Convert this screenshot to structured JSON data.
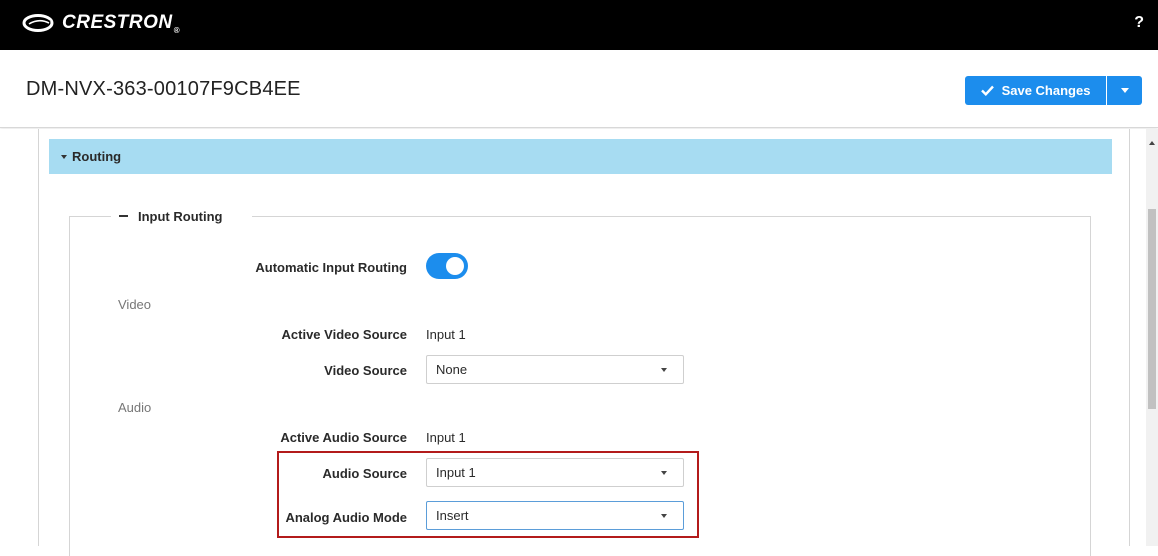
{
  "topbar": {
    "logo_text": "CRESTRON",
    "logo_mark": "®",
    "help_label": "?"
  },
  "header": {
    "device_name": "DM-NVX-363-00107F9CB4EE",
    "save_label": "Save Changes"
  },
  "routing": {
    "section_title": "Routing",
    "group_title": "Input Routing",
    "automatic_input_routing": {
      "label": "Automatic Input Routing",
      "enabled": true
    },
    "video": {
      "heading": "Video",
      "active_source_label": "Active Video Source",
      "active_source_value": "Input 1",
      "source_label": "Video Source",
      "source_value": "None"
    },
    "audio": {
      "heading": "Audio",
      "active_source_label": "Active Audio Source",
      "active_source_value": "Input 1",
      "source_label": "Audio Source",
      "source_value": "Input 1",
      "analog_mode_label": "Analog Audio Mode",
      "analog_mode_value": "Insert"
    }
  },
  "colors": {
    "topbar_bg": "#000000",
    "accent_blue": "#1c8ded",
    "section_bar": "#a7dcf2",
    "highlight_red": "#b31b1b"
  },
  "icons": [
    "crestron-logo-icon",
    "help-icon",
    "checkmark-icon",
    "chevron-down-icon",
    "caret-down-icon",
    "minus-icon"
  ]
}
